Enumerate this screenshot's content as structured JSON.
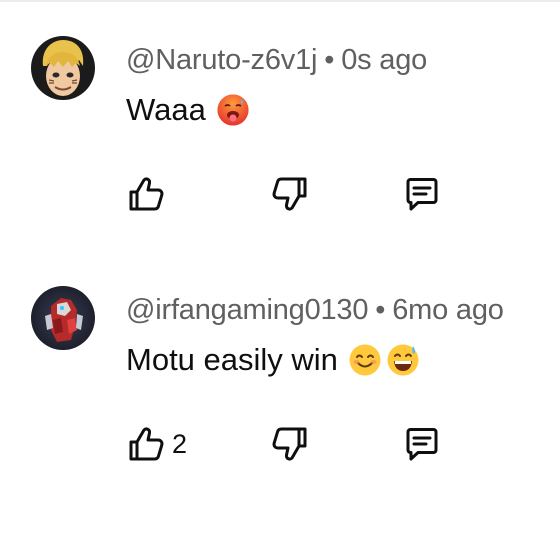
{
  "comments": [
    {
      "author": "@Naruto-z6v1j",
      "separator": "•",
      "time": "0s ago",
      "text": "Waaa",
      "emojis": [
        "hot-face-emoji"
      ],
      "like_count": "",
      "avatar": "anime-blonde-character-avatar"
    },
    {
      "author": "@irfangaming0130",
      "separator": "•",
      "time": "6mo ago",
      "text": "Motu easily win",
      "emojis": [
        "smiling-face-emoji",
        "grinning-sweat-emoji"
      ],
      "like_count": "2",
      "avatar": "red-armored-character-avatar"
    }
  ],
  "icons": {
    "like": "thumbs-up-icon",
    "dislike": "thumbs-down-icon",
    "reply": "reply-comment-icon"
  },
  "colors": {
    "meta_text": "#606060",
    "body_text": "#0f0f0f",
    "background": "#ffffff"
  }
}
